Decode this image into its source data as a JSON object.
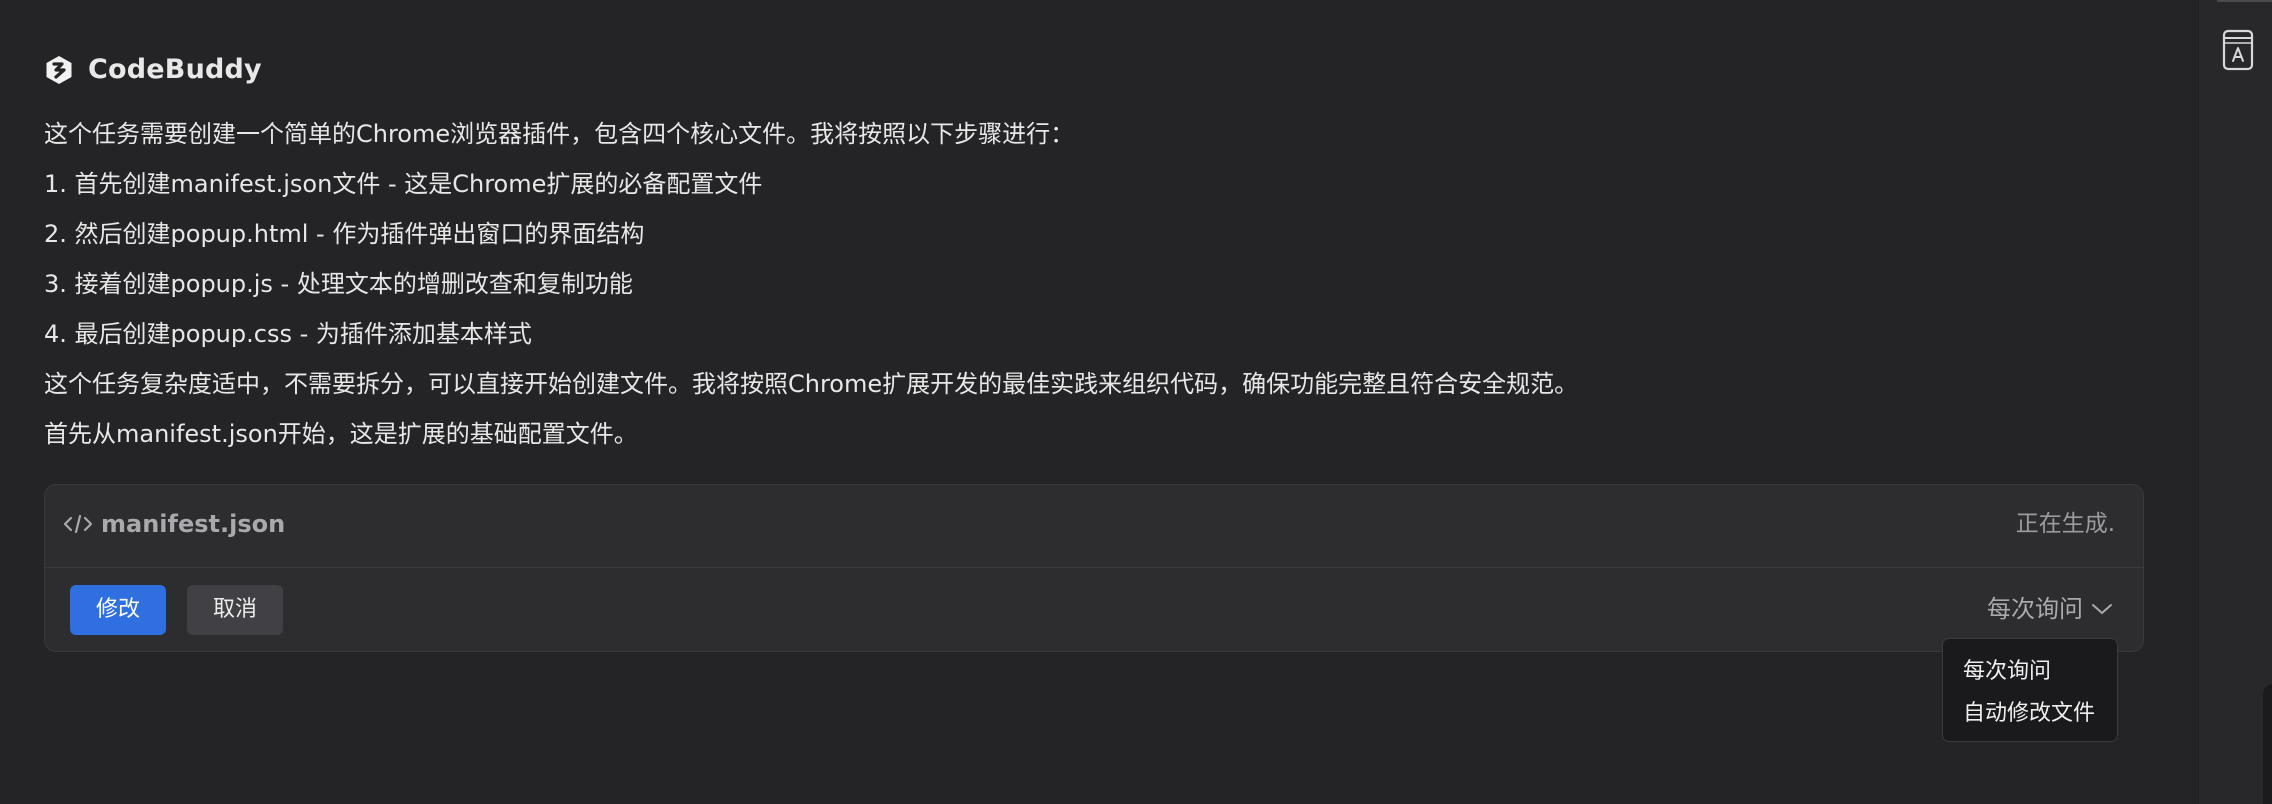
{
  "header": {
    "brand": "CodeBuddy",
    "logo_icon": "codebuddy-logo-icon"
  },
  "message": {
    "lines": [
      "这个任务需要创建一个简单的Chrome浏览器插件，包含四个核心文件。我将按照以下步骤进行：",
      "1. 首先创建manifest.json文件 - 这是Chrome扩展的必备配置文件",
      "2. 然后创建popup.html - 作为插件弹出窗口的界面结构",
      "3. 接着创建popup.js - 处理文本的增删改查和复制功能",
      "4. 最后创建popup.css - 为插件添加基本样式",
      "这个任务复杂度适中，不需要拆分，可以直接开始创建文件。我将按照Chrome扩展开发的最佳实践来组织代码，确保功能完整且符合安全规范。",
      "首先从manifest.json开始，这是扩展的基础配置文件。"
    ]
  },
  "file_card": {
    "icon": "code-icon",
    "file_name": "manifest.json",
    "status": "正在生成.",
    "buttons": {
      "modify": "修改",
      "cancel": "取消"
    },
    "mode_select": {
      "selected": "每次询问",
      "icon": "chevron-down-icon"
    }
  },
  "dropdown": {
    "options": [
      "每次询问",
      "自动修改文件"
    ]
  },
  "right_rail": {
    "icon": "dictionary-book-icon"
  },
  "colors": {
    "background": "#242427",
    "card": "#2d2d30",
    "primary": "#2f6fe0",
    "dropdown_bg": "#1a1a1c"
  }
}
